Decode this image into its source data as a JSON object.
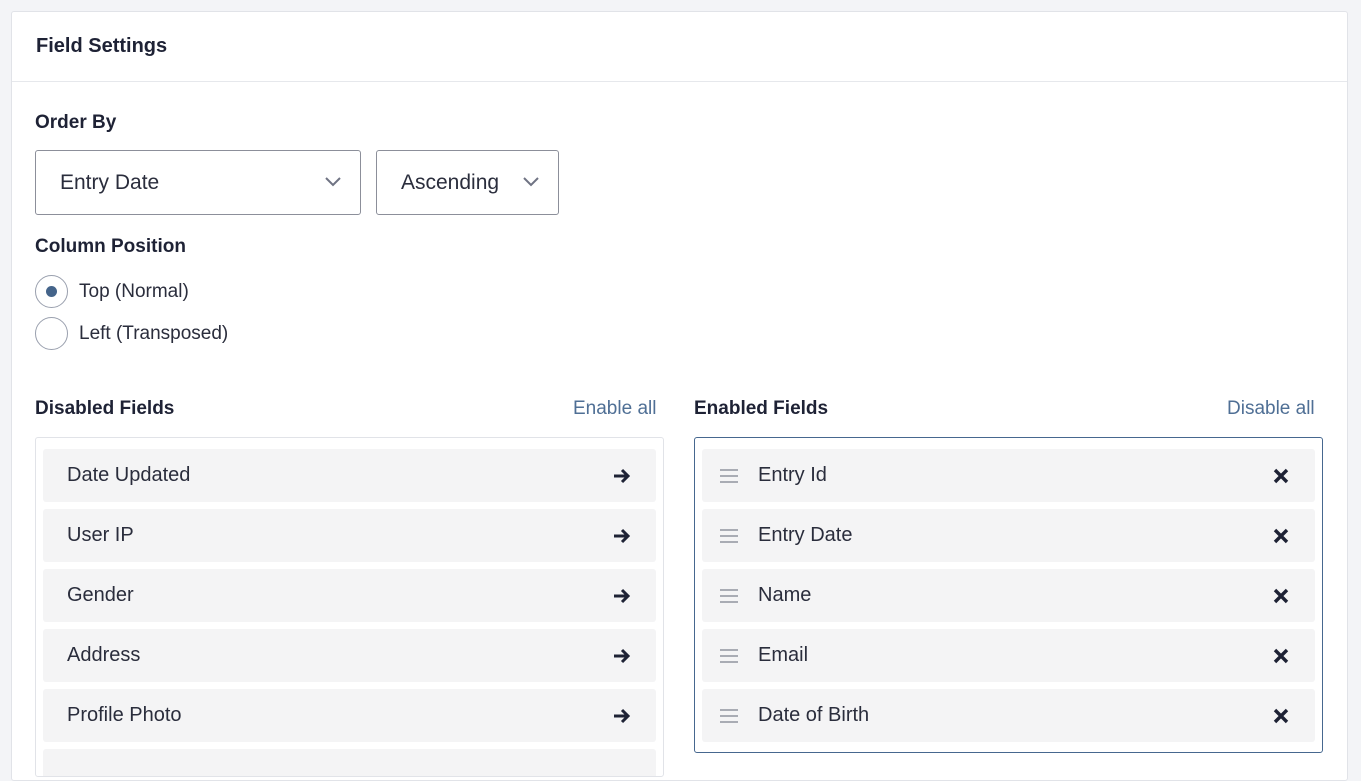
{
  "panel": {
    "title": "Field Settings"
  },
  "order_by": {
    "label": "Order By",
    "field_select": {
      "value": "Entry Date"
    },
    "direction_select": {
      "value": "Ascending"
    }
  },
  "column_position": {
    "label": "Column Position",
    "options": [
      {
        "label": "Top (Normal)",
        "selected": true
      },
      {
        "label": "Left (Transposed)",
        "selected": false
      }
    ]
  },
  "disabled_fields": {
    "label": "Disabled Fields",
    "action_label": "Enable all",
    "items": [
      "Date Updated",
      "User IP",
      "Gender",
      "Address",
      "Profile Photo",
      ""
    ]
  },
  "enabled_fields": {
    "label": "Enabled Fields",
    "action_label": "Disable all",
    "items": [
      "Entry Id",
      "Entry Date",
      "Name",
      "Email",
      "Date of Birth"
    ]
  },
  "icons": {
    "add": "arrow-right-icon",
    "remove": "close-icon",
    "drag": "drag-handle-icon",
    "dropdown": "chevron-down-icon"
  },
  "colors": {
    "accent": "#46678f",
    "link": "#4f6f95",
    "radio_selected": "#44648a",
    "item_bg": "#f4f4f5",
    "text": "#1e2235"
  }
}
